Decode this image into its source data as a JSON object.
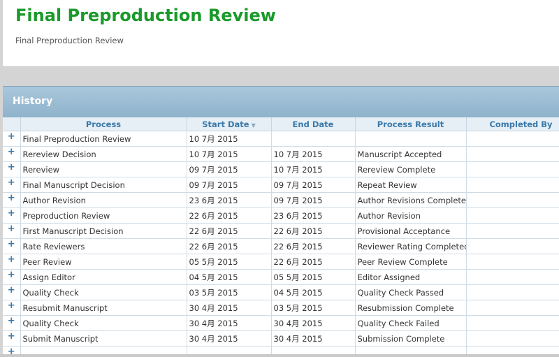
{
  "header": {
    "title": "Final Preproduction Review",
    "subtitle": "Final Preproduction Review"
  },
  "history": {
    "title": "History",
    "columns": [
      "Process",
      "Start Date",
      "End Date",
      "Process Result",
      "Completed By"
    ],
    "expand_symbol": "+",
    "sort_icon": "sort-desc-icon",
    "rows": [
      {
        "process": "Final Preproduction Review",
        "start": "10 7月 2015",
        "end": "",
        "result": "",
        "by": ""
      },
      {
        "process": "Rereview Decision",
        "start": "10 7月 2015",
        "end": "10 7月 2015",
        "result": "Manuscript Accepted",
        "by": ""
      },
      {
        "process": "Rereview",
        "start": "09 7月 2015",
        "end": "10 7月 2015",
        "result": "Rereview Complete",
        "by": ""
      },
      {
        "process": "Final Manuscript Decision",
        "start": "09 7月 2015",
        "end": "09 7月 2015",
        "result": "Repeat Review",
        "by": ""
      },
      {
        "process": "Author Revision",
        "start": "23 6月 2015",
        "end": "09 7月 2015",
        "result": "Author Revisions Complete",
        "by": ""
      },
      {
        "process": "Preproduction Review",
        "start": "22 6月 2015",
        "end": "23 6月 2015",
        "result": "Author Revision",
        "by": ""
      },
      {
        "process": "First Manuscript Decision",
        "start": "22 6月 2015",
        "end": "22 6月 2015",
        "result": "Provisional Acceptance",
        "by": ""
      },
      {
        "process": "Rate Reviewers",
        "start": "22 6月 2015",
        "end": "22 6月 2015",
        "result": "Reviewer Rating Completed",
        "by": ""
      },
      {
        "process": "Peer Review",
        "start": "05 5月 2015",
        "end": "22 6月 2015",
        "result": "Peer Review Complete",
        "by": ""
      },
      {
        "process": "Assign Editor",
        "start": "04 5月 2015",
        "end": "05 5月 2015",
        "result": "Editor Assigned",
        "by": ""
      },
      {
        "process": "Quality Check",
        "start": "03 5月 2015",
        "end": "04 5月 2015",
        "result": "Quality Check Passed",
        "by": ""
      },
      {
        "process": "Resubmit Manuscript",
        "start": "30 4月 2015",
        "end": "03 5月 2015",
        "result": "Resubmission Complete",
        "by": ""
      },
      {
        "process": "Quality Check",
        "start": "30 4月 2015",
        "end": "30 4月 2015",
        "result": "Quality Check Failed",
        "by": ""
      },
      {
        "process": "Submit Manuscript",
        "start": "30 4月 2015",
        "end": "30 4月 2015",
        "result": "Submission Complete",
        "by": ""
      },
      {
        "process": "",
        "start": "",
        "end": "",
        "result": "",
        "by": ""
      }
    ]
  },
  "colors": {
    "title_green": "#1a9a2a",
    "header_blue": "#3a78a8",
    "panel_header": "#9dbdd3"
  }
}
